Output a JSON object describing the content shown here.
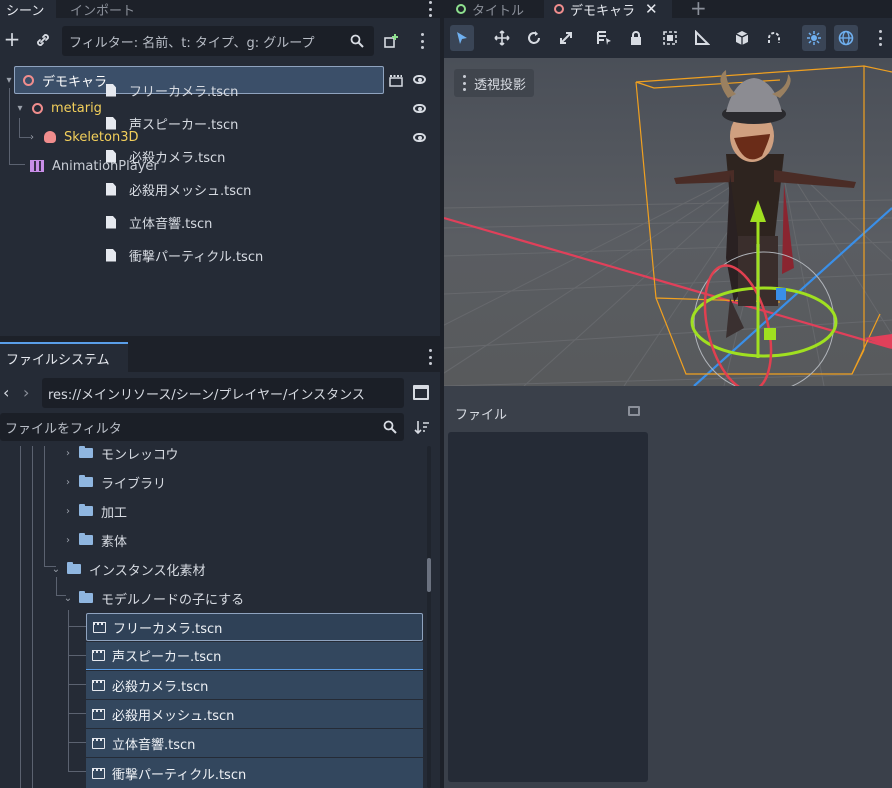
{
  "scene_panel": {
    "tabs": [
      "シーン",
      "インポート"
    ],
    "filter_placeholder": "フィルター: 名前、t: タイプ、g: グループ",
    "tree": [
      {
        "label": "デモキャラ",
        "icon": "node3d-icon"
      },
      {
        "label": "metarig",
        "icon": "node3d-icon"
      },
      {
        "label": "Skeleton3D",
        "icon": "skeleton-icon"
      },
      {
        "label": "AnimationPlayer",
        "icon": "animation-icon"
      }
    ],
    "drag_preview": [
      "フリーカメラ.tscn",
      "声スピーカー.tscn",
      "必殺カメラ.tscn",
      "必殺用メッシュ.tscn",
      "立体音響.tscn",
      "衝撃パーティクル.tscn"
    ]
  },
  "filesystem": {
    "tab": "ファイルシステム",
    "path": "res://メインリソース/シーン/プレイヤー/インスタンス",
    "filter_placeholder": "ファイルをフィルタ",
    "folders": [
      "モンレッコウ",
      "ライブラリ",
      "加工",
      "素体",
      "インスタンス化素材",
      "モデルノードの子にする"
    ],
    "files": [
      "フリーカメラ.tscn",
      "声スピーカー.tscn",
      "必殺カメラ.tscn",
      "必殺用メッシュ.tscn",
      "立体音響.tscn",
      "衝撃パーティクル.tscn"
    ]
  },
  "editor_tabs": [
    "タイトル",
    "デモキャラ"
  ],
  "viewport": {
    "mode_label": "透視投影",
    "colors": {
      "x_axis": "#e0405a",
      "z_axis": "#3a8fe8",
      "bbox": "#f0a020",
      "gizmo_green": "#a0e020"
    }
  },
  "bottom_panel": {
    "title": "ファイル"
  }
}
